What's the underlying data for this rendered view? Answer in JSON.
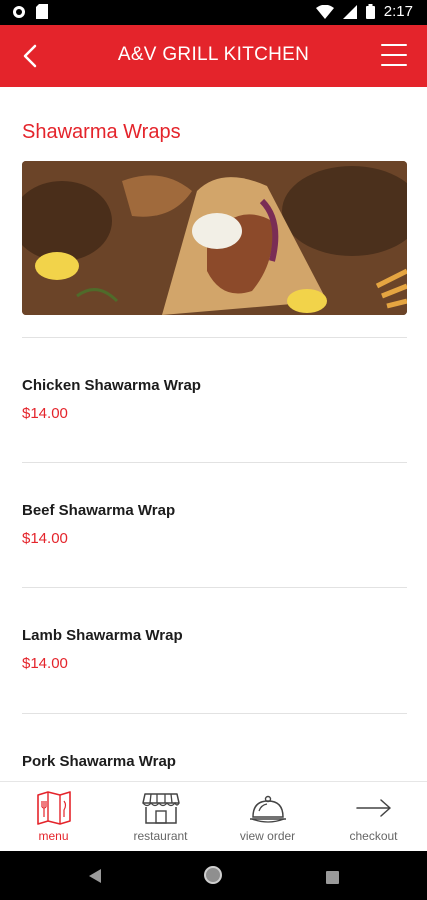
{
  "status_bar": {
    "time": "2:17"
  },
  "app_bar": {
    "title": "A&V GRILL KITCHEN"
  },
  "section": {
    "title": "Shawarma Wraps"
  },
  "menu_items": [
    {
      "name": "Chicken Shawarma Wrap",
      "price": "$14.00"
    },
    {
      "name": "Beef Shawarma Wrap",
      "price": "$14.00"
    },
    {
      "name": "Lamb Shawarma Wrap",
      "price": "$14.00"
    },
    {
      "name": "Pork Shawarma Wrap",
      "price": ""
    }
  ],
  "bottom_nav": [
    {
      "label": "menu",
      "icon": "menu-map-icon",
      "active": true
    },
    {
      "label": "restaurant",
      "icon": "storefront-icon",
      "active": false
    },
    {
      "label": "view order",
      "icon": "cloche-icon",
      "active": false
    },
    {
      "label": "checkout",
      "icon": "arrow-right-icon",
      "active": false
    }
  ],
  "colors": {
    "accent": "#e4242b",
    "text": "#1c1c1c",
    "muted": "#666666"
  }
}
